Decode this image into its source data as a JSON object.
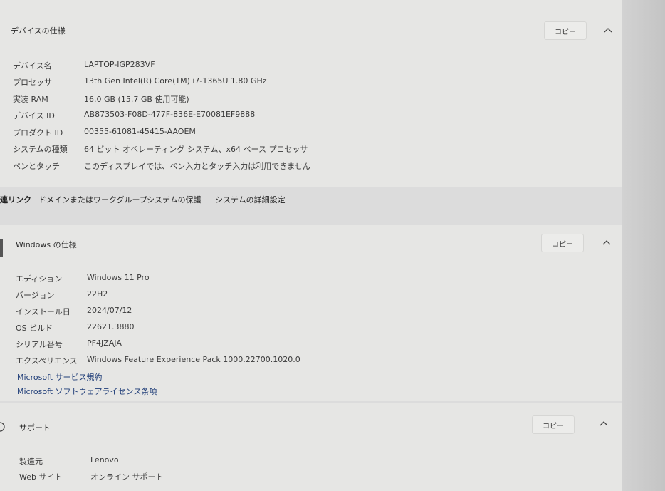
{
  "device_spec": {
    "title": "デバイスの仕様",
    "copy_label": "コピー",
    "rows": [
      {
        "key": "デバイス名",
        "value": "LAPTOP-IGP283VF"
      },
      {
        "key": "プロセッサ",
        "value": "13th Gen Intel(R) Core(TM) i7-1365U   1.80 GHz"
      },
      {
        "key": "実装 RAM",
        "value": "16.0 GB (15.7 GB 使用可能)"
      },
      {
        "key": "デバイス ID",
        "value": "AB873503-F08D-477F-836E-E70081EF9888"
      },
      {
        "key": "プロダクト ID",
        "value": "00355-61081-45415-AAOEM"
      },
      {
        "key": "システムの種類",
        "value": "64 ビット オペレーティング システム、x64 ベース プロセッサ"
      },
      {
        "key": "ペンとタッチ",
        "value": "このディスプレイでは、ペン入力とタッチ入力は利用できません"
      }
    ]
  },
  "related_links": {
    "label": "連リンク",
    "items": [
      "ドメインまたはワークグループ",
      "システムの保護",
      "システムの詳細設定"
    ]
  },
  "windows_spec": {
    "title": "Windows の仕様",
    "copy_label": "コピー",
    "rows": [
      {
        "key": "エディション",
        "value": "Windows 11 Pro"
      },
      {
        "key": "バージョン",
        "value": "22H2"
      },
      {
        "key": "インストール日",
        "value": "2024/07/12"
      },
      {
        "key": "OS ビルド",
        "value": "22621.3880"
      },
      {
        "key": "シリアル番号",
        "value": "PF4JZAJA"
      },
      {
        "key": "エクスペリエンス",
        "value": "Windows Feature Experience Pack 1000.22700.1020.0"
      }
    ],
    "links": [
      "Microsoft サービス規約",
      "Microsoft ソフトウェアライセンス条項"
    ]
  },
  "support": {
    "title": "サポート",
    "copy_label": "コピー",
    "rows": [
      {
        "key": "製造元",
        "value": "Lenovo"
      },
      {
        "key": "Web サイト",
        "value": "オンライン サポート"
      }
    ]
  }
}
